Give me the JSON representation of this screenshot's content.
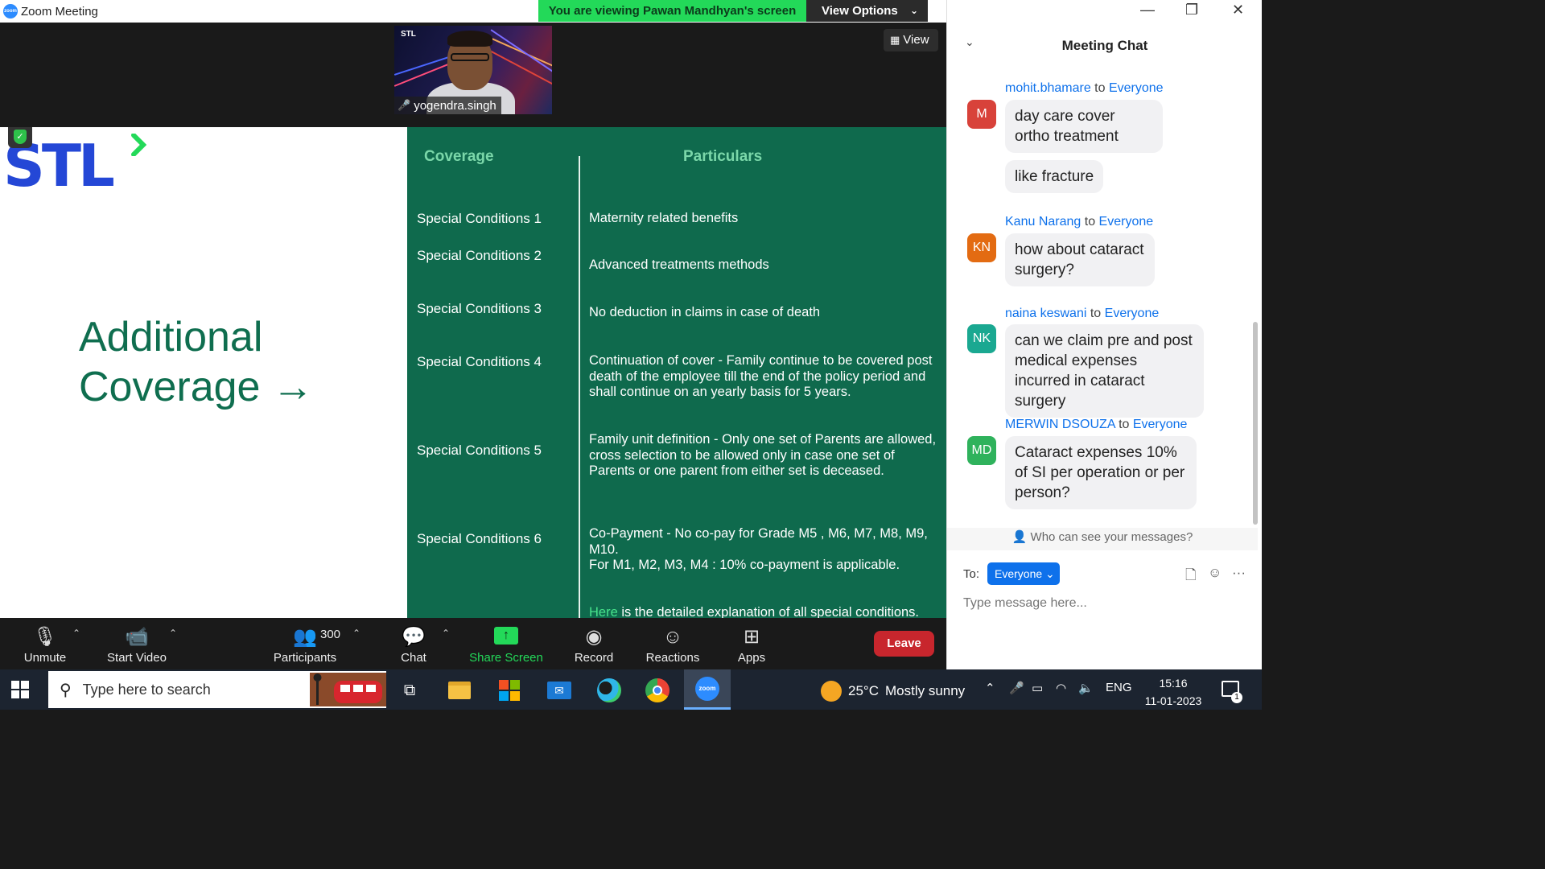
{
  "window": {
    "title": "Zoom Meeting",
    "viewing_banner": "You are viewing Pawan Mandhyan's screen",
    "view_options": "View Options",
    "view_button": "View"
  },
  "video": {
    "logo": "STL",
    "participant_name": "yogendra.singh"
  },
  "slide": {
    "logo": "STL",
    "heading_line1": "Additional",
    "heading_line2": "Coverage →",
    "col_coverage": "Coverage",
    "col_particulars": "Particulars",
    "rows": [
      {
        "label": "Special Conditions 1",
        "text": "Maternity related benefits"
      },
      {
        "label": "Special Conditions 2",
        "text": "Advanced treatments methods"
      },
      {
        "label": "Special Conditions 3",
        "text": "No deduction in claims in case of death"
      },
      {
        "label": "Special Conditions 4",
        "text": "Continuation of cover - Family continue to be covered post death of the employee till the end of the policy period and shall continue on an yearly basis for 5 years."
      },
      {
        "label": "Special Conditions 5",
        "text": "Family unit definition - Only one set of Parents are allowed, cross selection to be allowed only in case one set of Parents or one parent from either set is deceased."
      },
      {
        "label": "Special Conditions 6",
        "text_line1": "Co-Payment -  No co-pay for Grade M5 , M6, M7, M8, M9, M10.",
        "text_line2": "For M1, M2, M3, M4 : 10% co-payment is applicable."
      }
    ],
    "here_link": "Here",
    "here_rest": " is the detailed explanation of all special conditions."
  },
  "toolbar": {
    "unmute": "Unmute",
    "start_video": "Start Video",
    "participants": "Participants",
    "participants_count": "300",
    "chat": "Chat",
    "share_screen": "Share Screen",
    "record": "Record",
    "reactions": "Reactions",
    "apps": "Apps",
    "leave": "Leave"
  },
  "chat": {
    "title": "Meeting Chat",
    "to_word": "to",
    "messages": [
      {
        "sender": "mohit.bhamare",
        "recipient": "Everyone",
        "initials": "M",
        "color": "#d8423a",
        "bubbles": [
          "day care cover ortho treatment",
          "like fracture"
        ]
      },
      {
        "sender": "Kanu Narang",
        "recipient": "Everyone",
        "initials": "KN",
        "color": "#e36b12",
        "bubbles": [
          "how about cataract surgery?"
        ]
      },
      {
        "sender": "naina keswani",
        "recipient": "Everyone",
        "initials": "NK",
        "color": "#1aa891",
        "bubbles": [
          "can we claim pre and post medical expenses incurred in cataract  surgery"
        ]
      },
      {
        "sender": "MERWIN DSOUZA",
        "recipient": "Everyone",
        "initials": "MD",
        "color": "#2fb25c",
        "bubbles": [
          "Cataract expenses 10% of SI per operation or per person?"
        ]
      }
    ],
    "who_can_see": "Who can see your messages?",
    "to_label": "To:",
    "to_value": "Everyone",
    "input_placeholder": "Type message here..."
  },
  "taskbar": {
    "search_placeholder": "Type here to search",
    "weather_temp": "25°C",
    "weather_desc": "Mostly sunny",
    "language": "ENG",
    "time": "15:16",
    "date": "11-01-2023",
    "notification_count": "1"
  }
}
